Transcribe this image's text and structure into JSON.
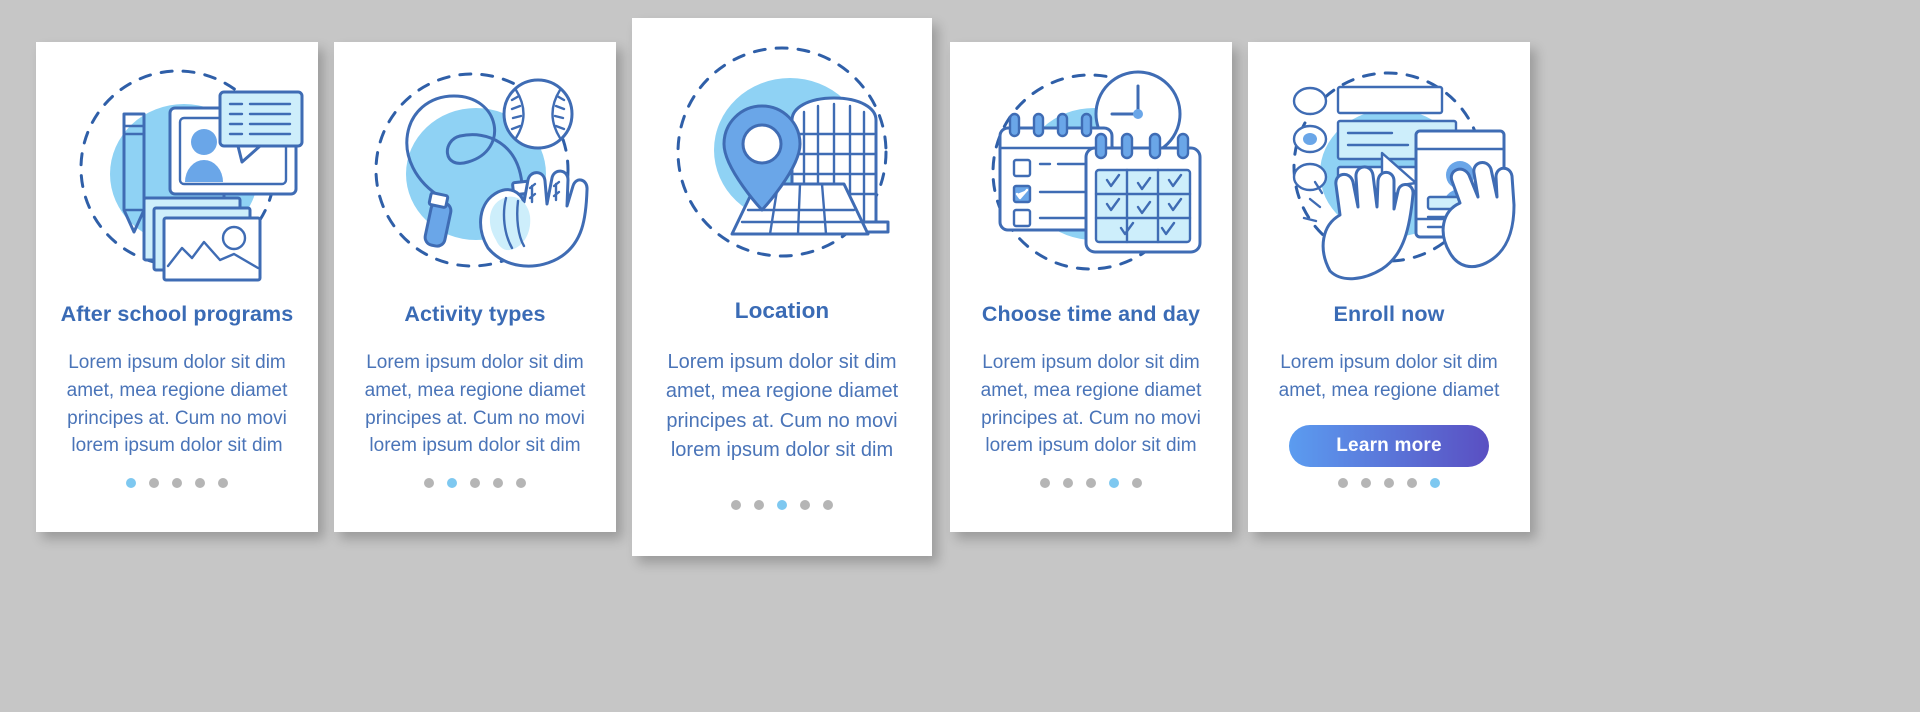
{
  "theme": {
    "page_background": "#c6c6c6",
    "card_background": "#ffffff",
    "title_color": "#3a6bb5",
    "body_color": "#4a74b8",
    "illustration_stroke": "#3f6cb4",
    "illustration_blob": "#8fd2f4",
    "dot_active_color": "#7ec8f0",
    "dot_inactive_color": "#b5b5b5",
    "cta_gradient_from": "#5b9cf0",
    "cta_gradient_to": "#5a4fc2",
    "cta_text_color": "#ffffff"
  },
  "pagination": {
    "total": 5
  },
  "screens": [
    {
      "id": "after-school-programs",
      "illustration": "computer-pencil-photos-icon",
      "title": "After school programs",
      "description": "Lorem ipsum dolor sit dim amet, mea regione diamet principes at. Cum no movi lorem ipsum dolor sit dim",
      "active_dot": 1,
      "featured": false
    },
    {
      "id": "activity-types",
      "illustration": "jumprope-baseball-glove-icon",
      "title": "Activity types",
      "description": "Lorem ipsum dolor sit dim amet, mea regione diamet principes at. Cum no movi lorem ipsum dolor sit dim",
      "active_dot": 2,
      "featured": false
    },
    {
      "id": "location",
      "illustration": "map-pin-stadium-icon",
      "title": "Location",
      "description": "Lorem ipsum dolor sit dim amet, mea regione diamet principes at. Cum no movi lorem ipsum dolor sit dim",
      "active_dot": 3,
      "featured": true
    },
    {
      "id": "choose-time-and-day",
      "illustration": "calendar-clock-checklist-icon",
      "title": "Choose time and day",
      "description": "Lorem ipsum dolor sit dim amet, mea regione diamet principes at. Cum no movi lorem ipsum dolor sit dim",
      "active_dot": 4,
      "featured": false
    },
    {
      "id": "enroll-now",
      "illustration": "hands-form-profile-icon",
      "title": "Enroll now",
      "description": "Lorem ipsum dolor sit dim amet, mea regione diamet",
      "cta_label": "Learn more",
      "active_dot": 5,
      "featured": false
    }
  ]
}
